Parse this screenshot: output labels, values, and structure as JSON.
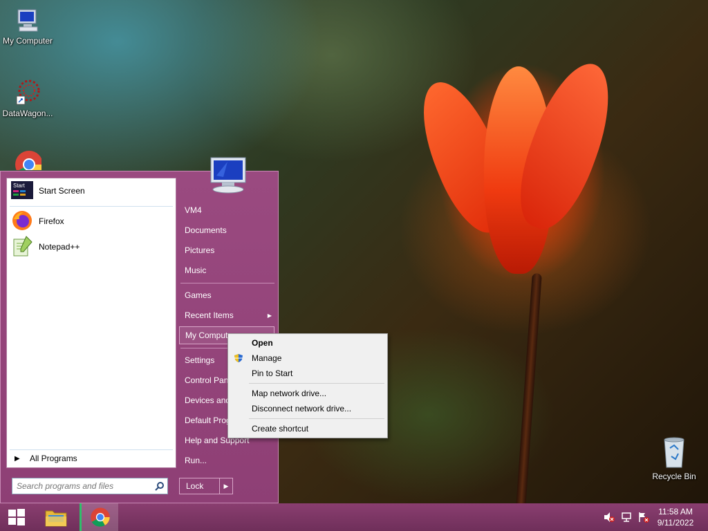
{
  "desktop": {
    "icons": [
      {
        "label": "My Computer",
        "icon": "computer-icon"
      },
      {
        "label": "DataWagon...",
        "icon": "datawagon-icon"
      },
      {
        "label": "Recycle Bin",
        "icon": "recycle-bin-icon"
      }
    ]
  },
  "start_menu": {
    "pinned": [
      {
        "label": "Start Screen",
        "icon": "start-screen-icon"
      },
      {
        "label": "Firefox",
        "icon": "firefox-icon"
      },
      {
        "label": "Notepad++",
        "icon": "notepadpp-icon"
      }
    ],
    "all_programs": "All Programs",
    "search_placeholder": "Search programs and files",
    "right_items": [
      {
        "label": "VM4"
      },
      {
        "label": "Documents"
      },
      {
        "label": "Pictures"
      },
      {
        "label": "Music"
      },
      {
        "label": "Games"
      },
      {
        "label": "Recent Items"
      },
      {
        "label": "My Comput"
      },
      {
        "label": "Settings"
      },
      {
        "label": "Control Pan"
      },
      {
        "label": "Devices and"
      },
      {
        "label": "Default Prog"
      },
      {
        "label": "Help and Support"
      },
      {
        "label": "Run..."
      }
    ],
    "lock_label": "Lock"
  },
  "context_menu": {
    "items": [
      {
        "label": "Open",
        "bold": true
      },
      {
        "label": "Manage"
      },
      {
        "label": "Pin to Start"
      },
      {
        "label": "Map network drive..."
      },
      {
        "label": "Disconnect network drive..."
      },
      {
        "label": "Create shortcut"
      }
    ]
  },
  "taskbar": {
    "clock_time": "11:58 AM",
    "clock_date": "9/11/2022"
  },
  "colors": {
    "start_menu_bg": "#9a4a80",
    "taskbar_bg": "#7a3563"
  }
}
